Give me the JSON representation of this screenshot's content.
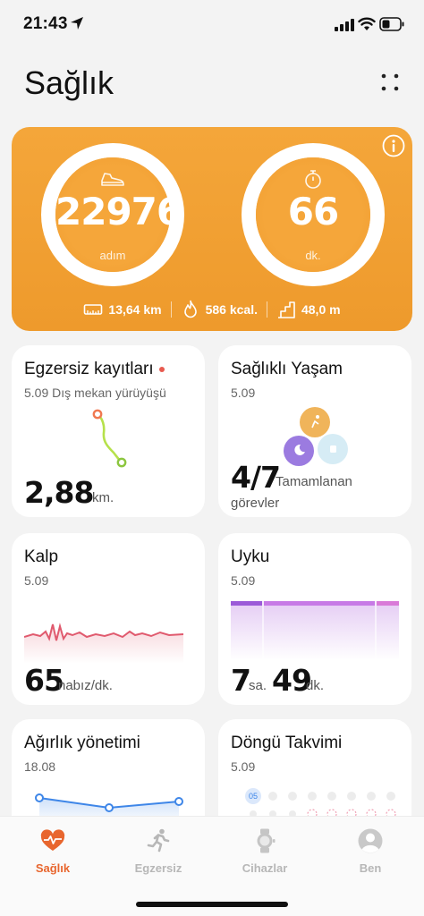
{
  "status_bar": {
    "time": "21:43"
  },
  "header": {
    "title": "Sağlık"
  },
  "hero": {
    "steps": {
      "value": "22976",
      "unit": "adım"
    },
    "active": {
      "value": "66",
      "unit": "dk."
    },
    "distance": "13,64 km",
    "calories": "586 kcal.",
    "elevation": "48,0 m",
    "accent_color": "#f2a134"
  },
  "cards": {
    "exercise": {
      "title": "Egzersiz kayıtları",
      "subtitle": "5.09 Dış mekan yürüyüşü",
      "value": "2,88",
      "unit": "km."
    },
    "healthy": {
      "title": "Sağlıklı Yaşam",
      "date": "5.09",
      "value": "4/7",
      "label_line1": "Tamamlanan",
      "label_line2": "görevler"
    },
    "heart": {
      "title": "Kalp",
      "date": "5.09",
      "value": "65",
      "unit": "nabız/dk."
    },
    "sleep": {
      "title": "Uyku",
      "date": "5.09",
      "hours": "7",
      "hours_unit": "sa.",
      "minutes": "49",
      "minutes_unit": "dk."
    },
    "weight": {
      "title": "Ağırlık yönetimi",
      "date": "18.08"
    },
    "cycle": {
      "title": "Döngü Takvimi",
      "date": "5.09",
      "day_badge": "05"
    }
  },
  "tabs": [
    {
      "label": "Sağlık",
      "icon": "heart-icon",
      "active": true
    },
    {
      "label": "Egzersiz",
      "icon": "runner-icon",
      "active": false
    },
    {
      "label": "Cihazlar",
      "icon": "watch-icon",
      "active": false
    },
    {
      "label": "Ben",
      "icon": "profile-icon",
      "active": false
    }
  ],
  "colors": {
    "active_tab": "#e8662e",
    "heart_line": "#e05a6e",
    "sleep_bar": "#b46ee0",
    "weight_line": "#3e86e8",
    "exercise_route": "#b6e14b"
  }
}
